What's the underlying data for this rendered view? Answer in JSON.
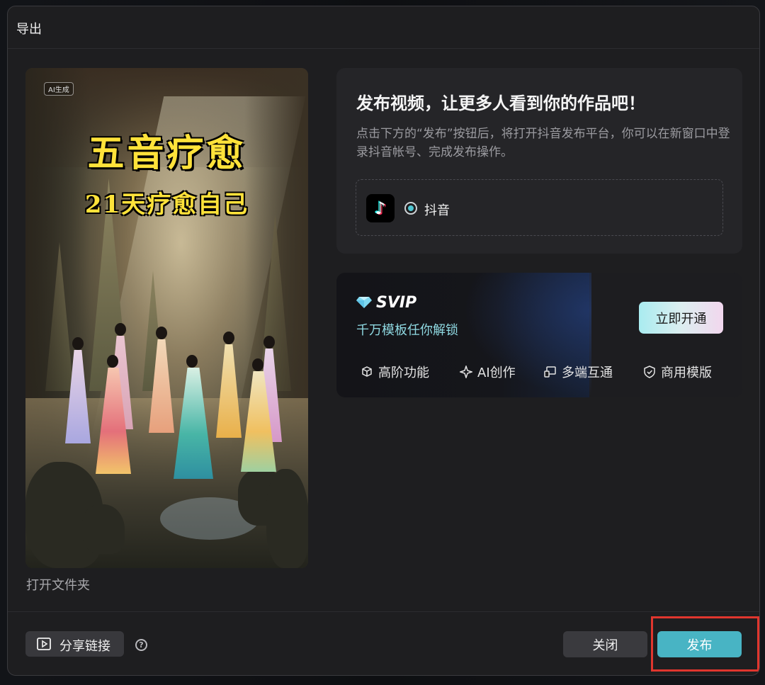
{
  "dialog": {
    "title": "导出"
  },
  "preview": {
    "ai_badge": "AI生成",
    "poster_title": "五音疗愈",
    "poster_subtitle": "21天疗愈自己",
    "open_folder_label": "打开文件夹"
  },
  "publish": {
    "title": "发布视频，让更多人看到你的作品吧！",
    "description": "点击下方的“发布”按钮后，将打开抖音发布平台，你可以在新窗口中登录抖音帐号、完成发布操作。",
    "platform": {
      "icon": "tiktok-logo",
      "label": "抖音",
      "selected": true
    }
  },
  "svip": {
    "title": "SVIP",
    "subtitle": "千万模板任你解锁",
    "activate_label": "立即开通",
    "features": [
      {
        "icon": "cube-icon",
        "label": "高阶功能"
      },
      {
        "icon": "sparkle-icon",
        "label": "AI创作"
      },
      {
        "icon": "devices-icon",
        "label": "多端互通"
      },
      {
        "icon": "shield-check-icon",
        "label": "商用模版"
      }
    ],
    "accent_color": "#8fd9e2"
  },
  "footer": {
    "share_label": "分享链接",
    "help": "?",
    "close_label": "关闭",
    "publish_label": "发布"
  },
  "colors": {
    "publish_button": "#48b4c4",
    "highlight": "#e0362e"
  }
}
